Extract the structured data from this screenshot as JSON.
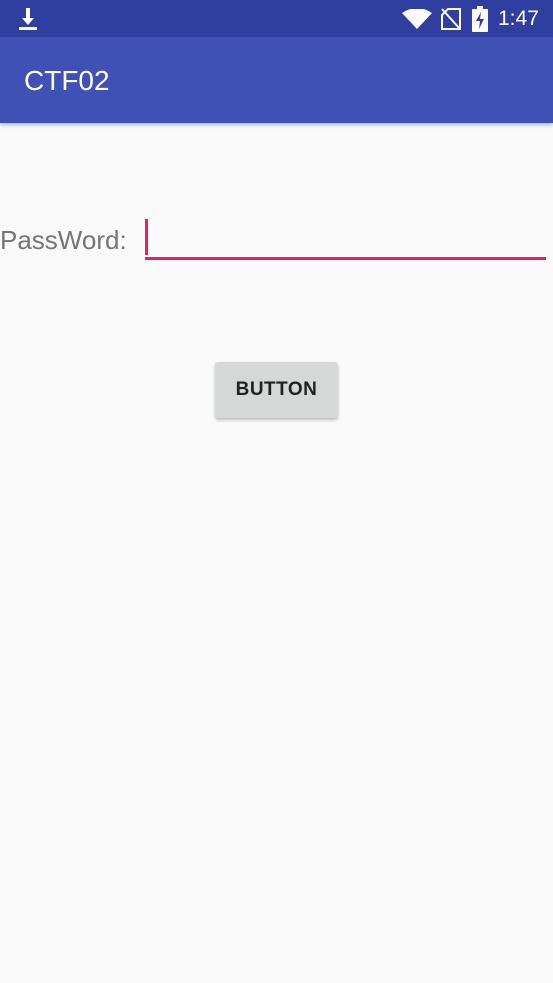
{
  "status_bar": {
    "time": "1:47",
    "icons": [
      "download-icon",
      "wifi-icon",
      "no-sim-icon",
      "battery-charging-icon"
    ],
    "color": "#303f9f"
  },
  "app_bar": {
    "title": "CTF02",
    "color": "#3f51b5"
  },
  "form": {
    "password_label": "PassWord:",
    "password_value": "",
    "input_accent": "#e91e63",
    "button_label": "BUTTON"
  }
}
